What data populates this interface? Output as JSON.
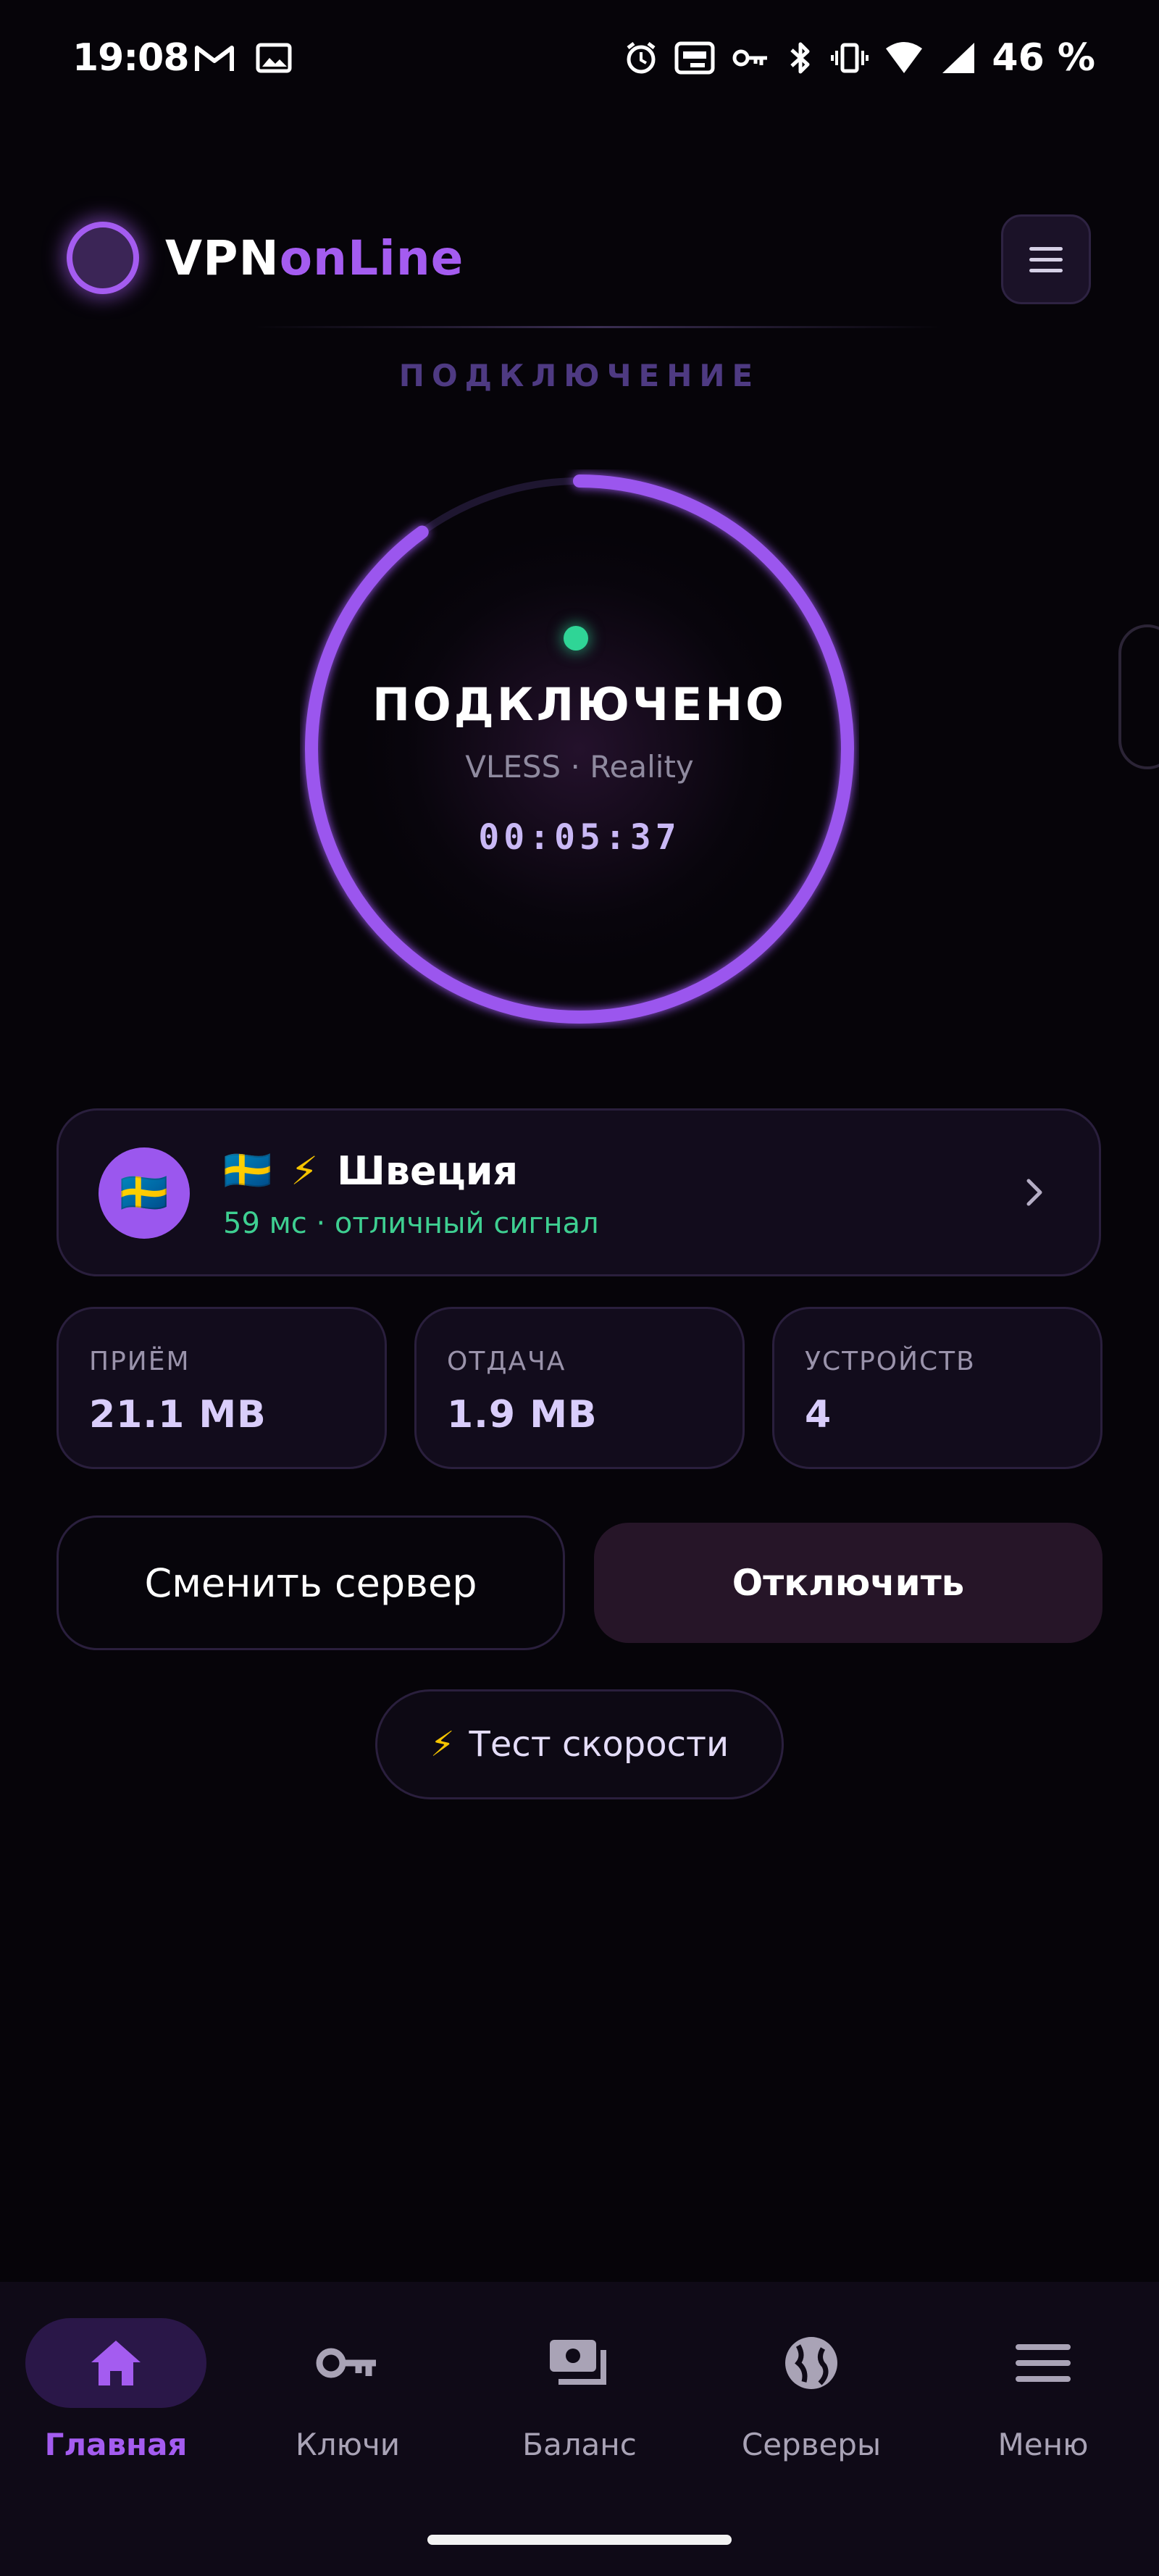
{
  "status_bar": {
    "time": "19:08",
    "battery": "46 %",
    "left_icons": [
      "gmail-icon",
      "gallery-icon"
    ],
    "right_icons": [
      "alarm-icon",
      "auto-hz-icon",
      "vpn-key-icon",
      "bluetooth-icon",
      "vibrate-icon",
      "wifi-icon",
      "signal-icon"
    ]
  },
  "header": {
    "brand_part1": "VPN",
    "brand_part2": "onLine",
    "section_label": "ПОДКЛЮЧЕНИЕ"
  },
  "connection": {
    "status": "ПОДКЛЮЧЕНО",
    "protocol": "VLESS · Reality",
    "timer": "00:05:37",
    "ring_progress": 0.9,
    "accent_color": "#9b57ee",
    "status_dot_color": "#2fd596"
  },
  "server": {
    "flag": "🇸🇪",
    "title_flag": "🇸🇪",
    "bolt": "⚡",
    "country": "Швеция",
    "subtitle": "59 мс · отличный сигнал"
  },
  "stats": [
    {
      "label": "ПРИЁМ",
      "value": "21.1 MB"
    },
    {
      "label": "ОТДАЧА",
      "value": "1.9 MB"
    },
    {
      "label": "УСТРОЙСТВ",
      "value": "4"
    }
  ],
  "actions": {
    "change_server": "Сменить сервер",
    "disconnect": "Отключить",
    "speed_test_icon": "⚡",
    "speed_test": "Тест скорости"
  },
  "nav": [
    {
      "label": "Главная",
      "icon": "home-icon",
      "active": true
    },
    {
      "label": "Ключи",
      "icon": "key-icon",
      "active": false
    },
    {
      "label": "Баланс",
      "icon": "wallet-icon",
      "active": false
    },
    {
      "label": "Серверы",
      "icon": "globe-icon",
      "active": false
    },
    {
      "label": "Меню",
      "icon": "menu-icon",
      "active": false
    }
  ]
}
